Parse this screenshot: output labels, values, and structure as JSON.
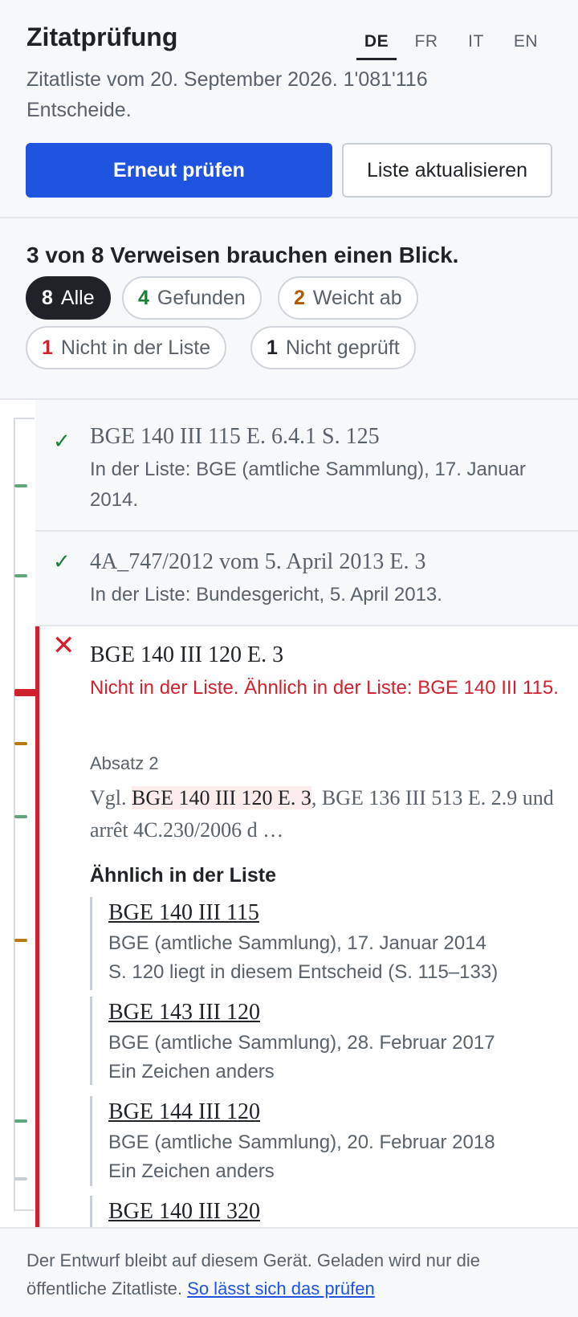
{
  "header": {
    "title": "Zitatprüfung",
    "languages": [
      "DE",
      "FR",
      "IT",
      "EN"
    ],
    "active_language": "DE",
    "subtitle": "Zitatliste vom 20. September 2026. 1'081'116 Entscheide.",
    "primary_button": "Erneut prüfen",
    "secondary_button": "Liste aktualisieren"
  },
  "summary": {
    "text": "3 von 8 Verweisen brauchen einen Blick.",
    "filters": [
      {
        "count": "8",
        "label": "Alle",
        "color": "#ffffff"
      },
      {
        "count": "4",
        "label": "Gefunden",
        "color": "#1a7f37"
      },
      {
        "count": "2",
        "label": "Weicht ab",
        "color": "#b35900"
      },
      {
        "count": "1",
        "label": "Nicht in der Liste",
        "color": "#cf222e"
      },
      {
        "count": "1",
        "label": "Nicht geprüft",
        "color": "#1f2328"
      }
    ]
  },
  "citations": [
    {
      "status": "found",
      "mark": "✓",
      "ref": "BGE 140 III 115 E. 6.4.1 S. 125",
      "desc": "In der Liste: BGE (amtliche Sammlung), 17. Januar 2014."
    },
    {
      "status": "found",
      "mark": "✓",
      "ref": "4A_747/2012 vom 5. April 2013 E. 3",
      "desc": "In der Liste: Bundesgericht, 5. April 2013."
    }
  ],
  "active": {
    "mark": "✕",
    "ref": "BGE 140 III 120 E. 3",
    "desc": "Nicht in der Liste. Ähnlich in der Liste: BGE 140 III 115.",
    "paragraph_label": "Absatz 2",
    "paragraph_prefix": "Vgl. ",
    "paragraph_highlight": "BGE 140 III 120 E. 3",
    "paragraph_suffix": ", BGE 136 III 513 E. 2.9 und arrêt 4C.230/2006 d …",
    "similar_title": "Ähnlich in der Liste",
    "similar": [
      {
        "ref": "BGE 140 III 115",
        "line1": "BGE (amtliche Sammlung), 17. Januar 2014",
        "line2": "S. 120 liegt in diesem Entscheid (S. 115–133)"
      },
      {
        "ref": "BGE 143 III 120",
        "line1": "BGE (amtliche Sammlung), 28. Februar 2017",
        "line2": "Ein Zeichen anders"
      },
      {
        "ref": "BGE 144 III 120",
        "line1": "BGE (amtliche Sammlung), 20. Februar 2018",
        "line2": "Ein Zeichen anders"
      },
      {
        "ref": "BGE 140 III 320",
        "line1": "",
        "line2": ""
      }
    ]
  },
  "rail": {
    "colors": {
      "found": "#5fa77a",
      "differs": "#b97a12",
      "missing": "#cf222e",
      "unchecked": "#c9ced4"
    }
  },
  "footer": {
    "text": "Der Entwurf bleibt auf diesem Gerät. Geladen wird nur die öffentliche Zitatliste.",
    "link": "So lässt sich das prüfen"
  }
}
